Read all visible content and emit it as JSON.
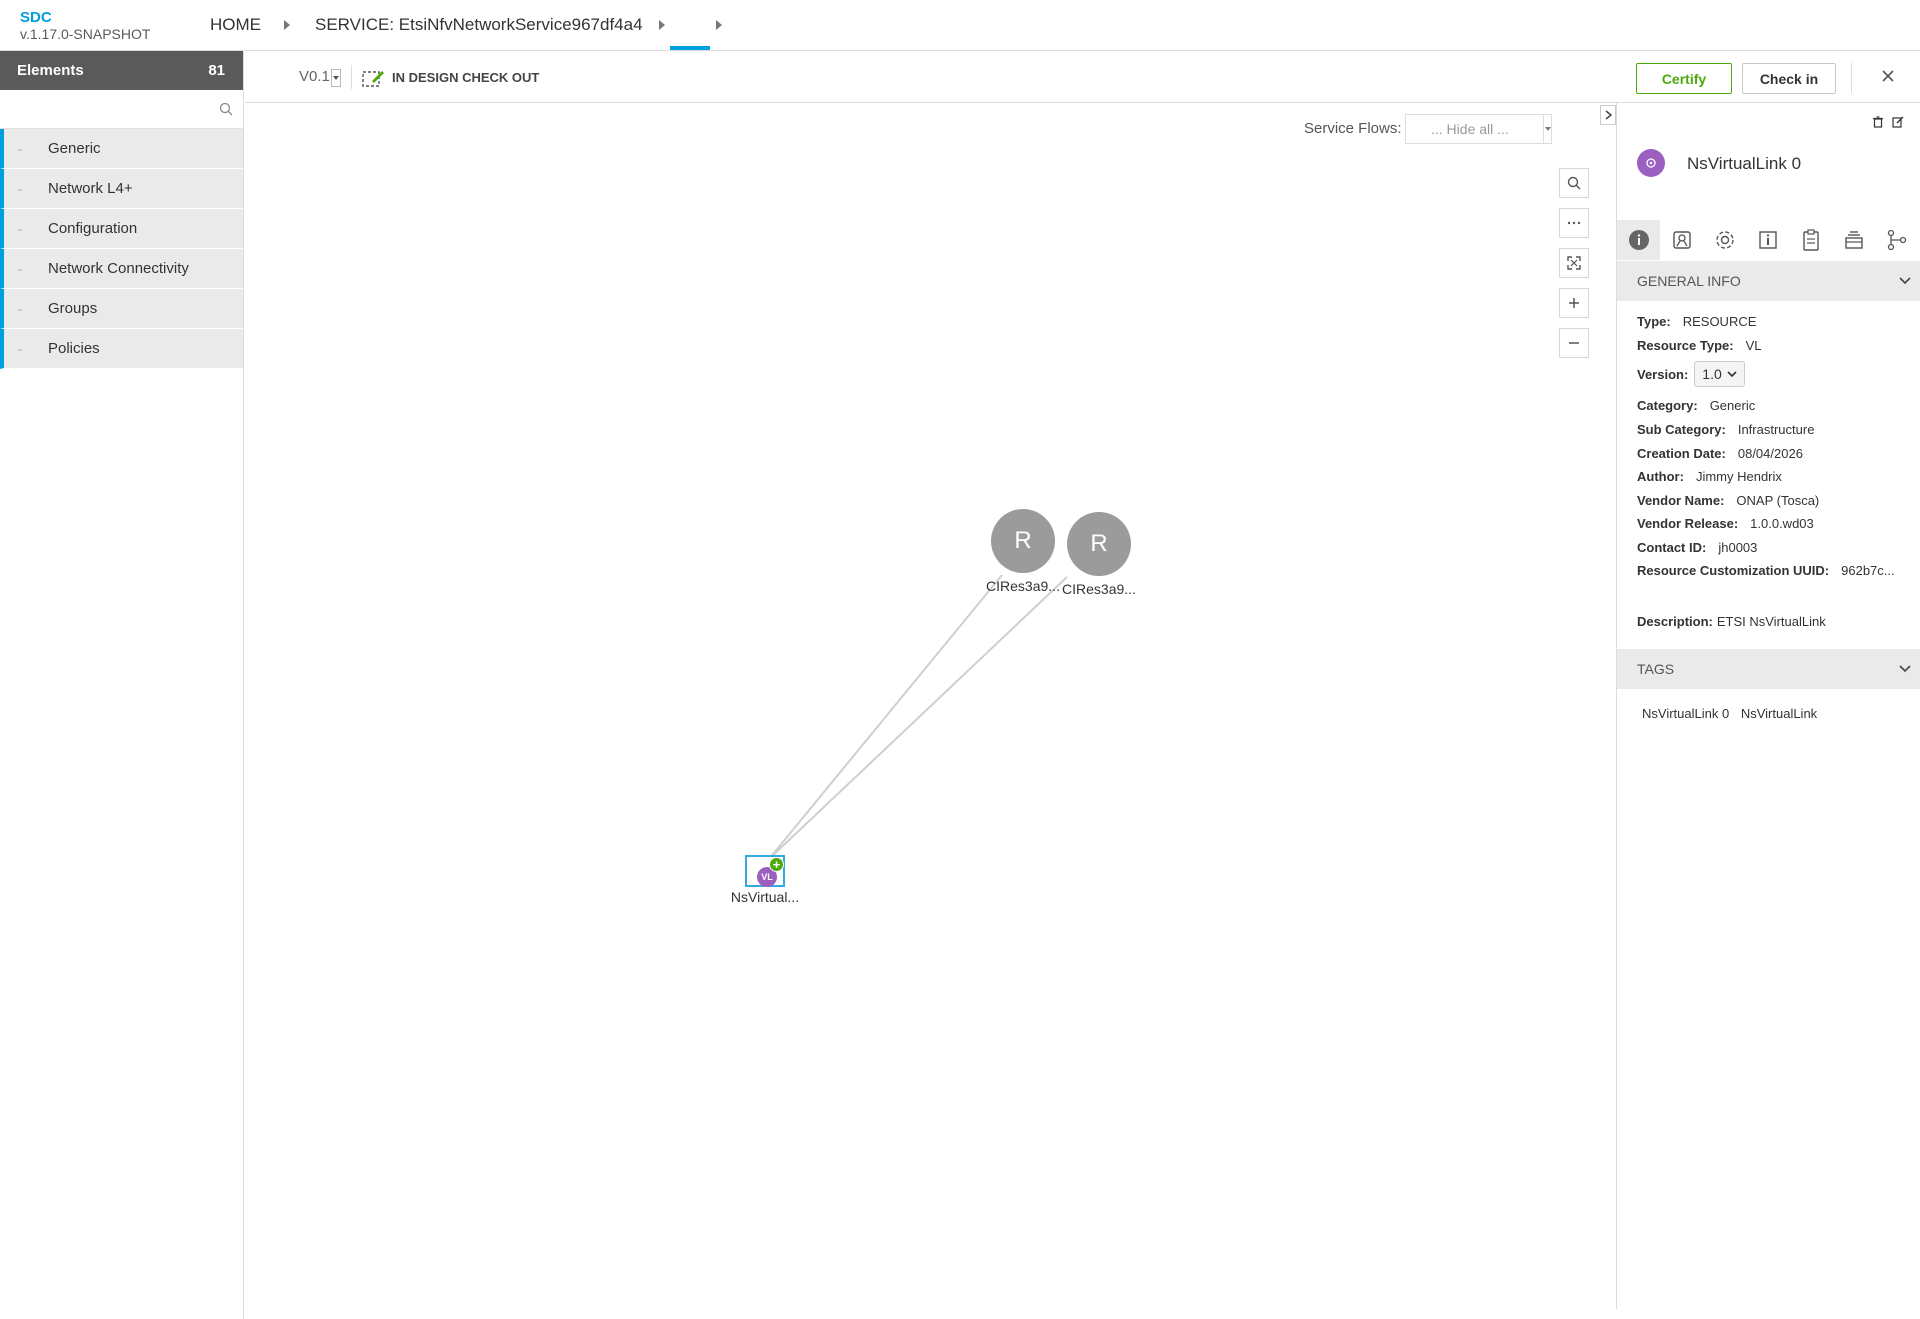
{
  "header": {
    "app_name": "SDC",
    "app_version": "v.1.17.0-SNAPSHOT",
    "breadcrumb_home": "HOME",
    "breadcrumb_service": "SERVICE: EtsiNfvNetworkService967df4a4"
  },
  "palette": {
    "title": "Elements",
    "count": "81",
    "search_placeholder": "",
    "groups": [
      {
        "label": "Generic",
        "marker": "-"
      },
      {
        "label": "Network L4+",
        "marker": "-"
      },
      {
        "label": "Configuration",
        "marker": "-"
      },
      {
        "label": "Network Connectivity",
        "marker": "-"
      },
      {
        "label": "Groups",
        "marker": "-"
      },
      {
        "label": "Policies",
        "marker": "-"
      }
    ]
  },
  "toolbar": {
    "version": "V0.1",
    "status": "IN DESIGN CHECK OUT",
    "certify_label": "Certify",
    "checkin_label": "Check in",
    "accent_green": "#4ca90c",
    "accent_blue": "#009fdb"
  },
  "canvas": {
    "service_flows_label": "Service Flows:",
    "service_flows_value": "... Hide all ...",
    "nodes": [
      {
        "letter": "R",
        "label": "CIRes3a9..."
      },
      {
        "letter": "R",
        "label": "CIRes3a9..."
      },
      {
        "letter": "VL",
        "label": "NsVirtual..."
      }
    ],
    "zoom_controls": [
      "search-icon",
      "more-icon",
      "fit-icon",
      "zoom-in-icon",
      "zoom-out-icon"
    ]
  },
  "panel": {
    "title": "NsVirtualLink 0",
    "general_info_title": "GENERAL INFO",
    "tags_title": "TAGS",
    "info": {
      "type_label": "Type:",
      "type_value": "RESOURCE",
      "resource_type_label": "Resource Type:",
      "resource_type_value": "VL",
      "version_label": "Version:",
      "version_value": "1.0",
      "category_label": "Category:",
      "category_value": "Generic",
      "sub_category_label": "Sub Category:",
      "sub_category_value": "Infrastructure",
      "creation_date_label": "Creation Date:",
      "creation_date_value": "08/04/2026",
      "author_label": "Author:",
      "author_value": "Jimmy Hendrix",
      "vendor_name_label": "Vendor Name:",
      "vendor_name_value": "ONAP (Tosca)",
      "vendor_release_label": "Vendor Release:",
      "vendor_release_value": "1.0.0.wd03",
      "contact_id_label": "Contact ID:",
      "contact_id_value": "jh0003",
      "customization_uuid_label": "Resource Customization UUID:",
      "customization_uuid_value": "962b7c...",
      "description_label": "Description:",
      "description_value": "ETSI NsVirtualLink"
    },
    "tags": [
      "NsVirtualLink 0",
      "NsVirtualLink"
    ],
    "tabs": [
      "info-icon",
      "deployment-icon",
      "settings-icon",
      "properties-icon",
      "artifacts-icon",
      "groups-icon",
      "relations-icon"
    ],
    "vl_color": "#9b5fc0"
  }
}
